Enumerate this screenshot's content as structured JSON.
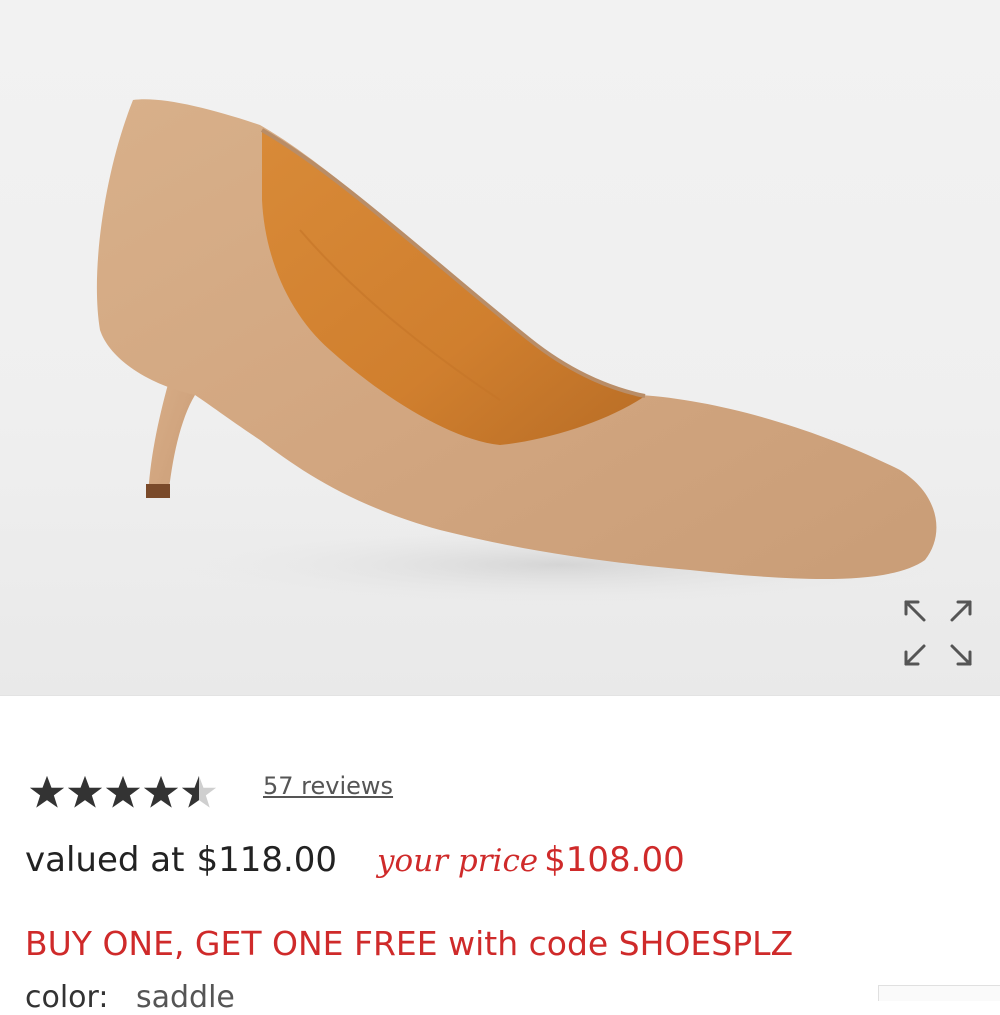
{
  "product": {
    "image_alt": "Suede kitten-heel pump",
    "rating_value": 4.5,
    "rating_max": 5,
    "reviews_label": "57 reviews",
    "valued_label": "valued at",
    "valued_price": "$118.00",
    "your_price_label": "your price",
    "sale_price": "$108.00",
    "promo_text": "BUY ONE, GET ONE FREE with code SHOESPLZ",
    "color_label": "color:",
    "color_value": "saddle"
  },
  "icons": {
    "expand": "expand-icon",
    "star": "star-icon"
  },
  "colors": {
    "accent_red": "#cf2a2a",
    "star_fill": "#333333",
    "text_dark": "#222222"
  }
}
